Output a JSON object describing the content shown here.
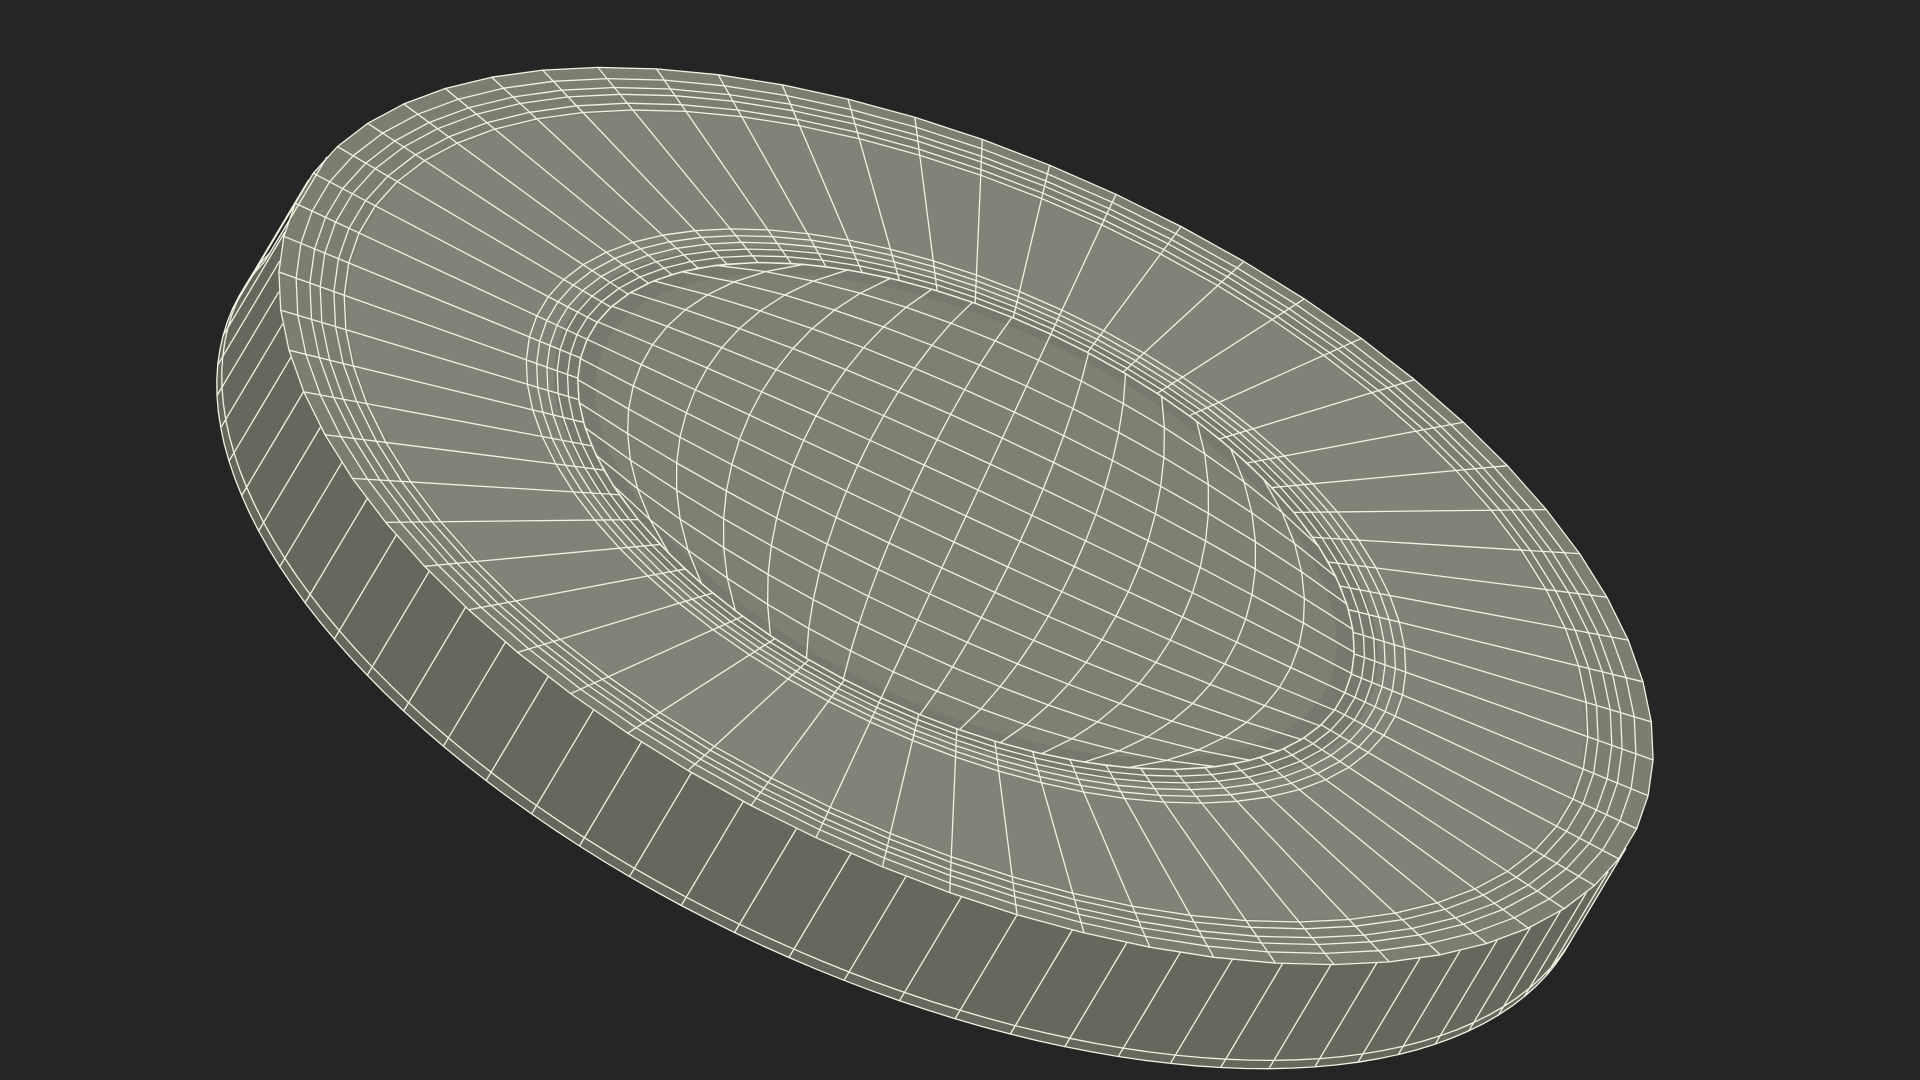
{
  "scene": {
    "subject": "wireframe-coin-model",
    "colors": {
      "background": "#252525",
      "surface": "#7c7e70",
      "surface_light": "#8a8c7e",
      "surface_dark": "#66685b",
      "edge": "#f2f2e2"
    }
  }
}
